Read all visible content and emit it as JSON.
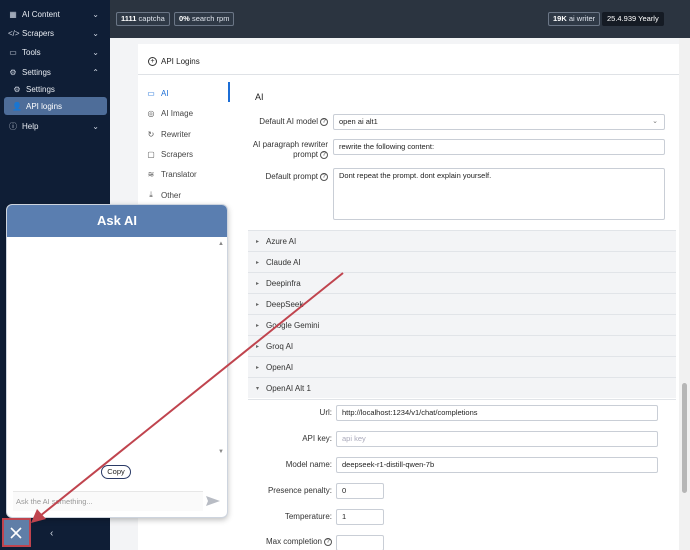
{
  "sidebar": {
    "items": [
      {
        "label": "AI Content",
        "icon": "grid-icon"
      },
      {
        "label": "Scrapers",
        "icon": "code-icon"
      },
      {
        "label": "Tools",
        "icon": "briefcase-icon"
      },
      {
        "label": "Settings",
        "icon": "gear-icon"
      },
      {
        "label": "Settings",
        "icon": "gear-icon"
      },
      {
        "label": "API logins",
        "icon": "user-icon"
      },
      {
        "label": "Help",
        "icon": "help-icon"
      }
    ]
  },
  "topbar": {
    "badges": [
      {
        "value": "1111",
        "label": "captcha"
      },
      {
        "value": "0%",
        "label": "search rpm"
      },
      {
        "value": "19K",
        "label": "ai writer"
      },
      {
        "value": "25.4.939",
        "label": "Yearly"
      }
    ]
  },
  "page": {
    "tab_label": "API Logins",
    "section_title": "AI",
    "subnav": [
      "AI",
      "AI Image",
      "Rewriter",
      "Scrapers",
      "Translator",
      "Other"
    ],
    "fields": {
      "default_model_label": "Default AI model",
      "default_model_value": "open ai alt1",
      "rewriter_prompt_label": "AI paragraph rewriter prompt",
      "rewriter_prompt_value": "rewrite the following content:",
      "default_prompt_label": "Default prompt",
      "default_prompt_value": "Dont repeat the prompt. dont explain yourself."
    },
    "accordion": [
      "Azure AI",
      "Claude AI",
      "Deepinfra",
      "DeepSeek",
      "Google Gemini",
      "Groq AI",
      "OpenAI",
      "OpenAI Alt 1"
    ],
    "alt1": {
      "url_label": "Url:",
      "url_value": "http://localhost:1234/v1/chat/completions",
      "apikey_label": "API key:",
      "apikey_placeholder": "api key",
      "model_label": "Model name:",
      "model_value": "deepseek-r1-distill-qwen-7b",
      "presence_label": "Presence penalty:",
      "presence_value": "0",
      "temperature_label": "Temperature:",
      "temperature_value": "1",
      "maxtokens_label": "Max completion"
    }
  },
  "askai": {
    "title": "Ask AI",
    "copy_label": "Copy",
    "input_placeholder": "Ask the AI something..."
  },
  "colors": {
    "sidebar_bg": "#0f1e36",
    "active_item": "#4e6d99",
    "accent": "#1c6ed6",
    "askai_header": "#5a7eb0",
    "annotation": "#c0444e"
  }
}
